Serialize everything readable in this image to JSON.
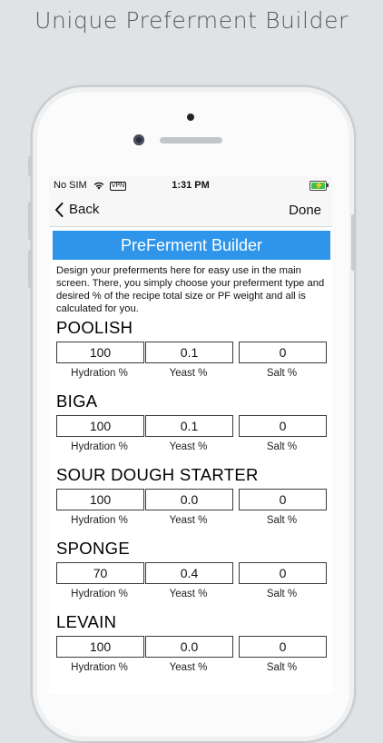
{
  "headline": "Unique Preferment Builder",
  "status_bar": {
    "carrier": "No SIM",
    "vpn": "VPN",
    "time": "1:31 PM"
  },
  "nav": {
    "back_label": "Back",
    "done_label": "Done"
  },
  "page": {
    "title": "PreFerment Builder",
    "description": "Design your preferments here for easy use in the main screen. There, you simply choose your preferment type and desired % of the recipe total size or PF weight and all is calculated for you."
  },
  "field_labels": [
    "Hydration %",
    "Yeast %",
    "Salt %"
  ],
  "preferments": [
    {
      "name": "POOLISH",
      "hydration": "100",
      "yeast": "0.1",
      "salt": "0"
    },
    {
      "name": "BIGA",
      "hydration": "100",
      "yeast": "0.1",
      "salt": "0"
    },
    {
      "name": "SOUR DOUGH STARTER",
      "hydration": "100",
      "yeast": "0.0",
      "salt": "0"
    },
    {
      "name": "SPONGE",
      "hydration": "70",
      "yeast": "0.4",
      "salt": "0"
    },
    {
      "name": "LEVAIN",
      "hydration": "100",
      "yeast": "0.0",
      "salt": "0"
    }
  ],
  "colors": {
    "title_bar": "#2e95ea",
    "battery": "#39c24a"
  }
}
